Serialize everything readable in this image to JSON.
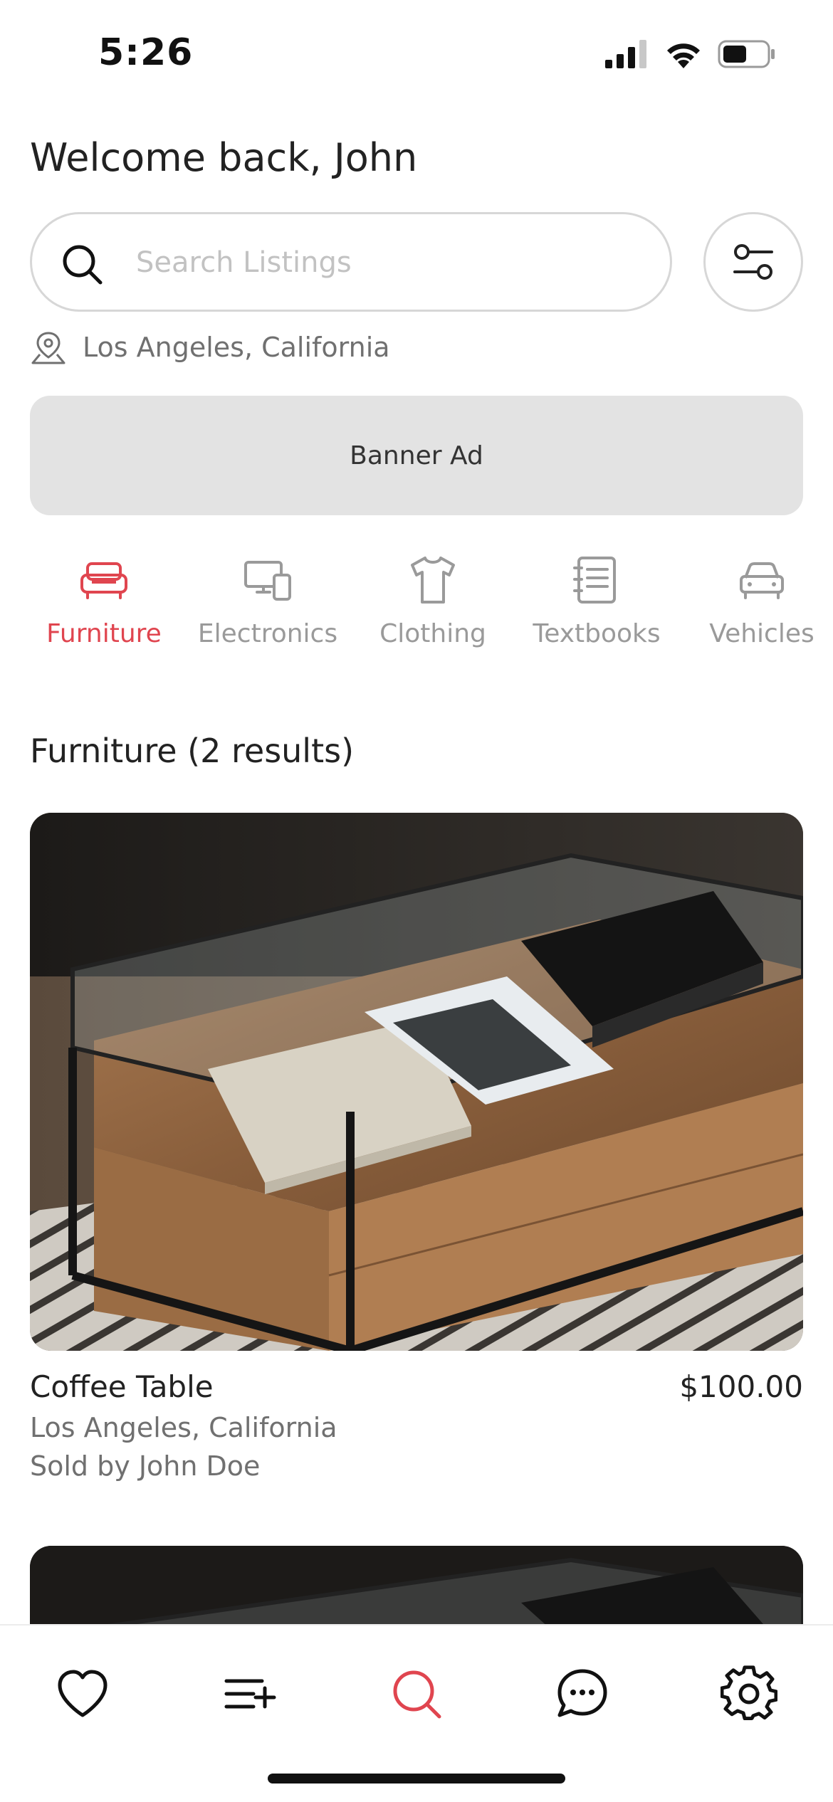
{
  "status_bar": {
    "time": "5:26"
  },
  "header": {
    "greeting": "Welcome back, John"
  },
  "search": {
    "placeholder": "Search Listings",
    "value": ""
  },
  "location": {
    "label": "Los Angeles, California"
  },
  "banner": {
    "label": "Banner Ad"
  },
  "categories": [
    {
      "label": "Furniture",
      "icon": "sofa-icon",
      "active": true
    },
    {
      "label": "Electronics",
      "icon": "devices-icon",
      "active": false
    },
    {
      "label": "Clothing",
      "icon": "shirt-icon",
      "active": false
    },
    {
      "label": "Textbooks",
      "icon": "notebook-icon",
      "active": false
    },
    {
      "label": "Vehicles",
      "icon": "car-icon",
      "active": false
    }
  ],
  "results": {
    "heading": "Furniture (2 results)"
  },
  "listings": [
    {
      "title": "Coffee Table",
      "price": "$100.00",
      "location": "Los Angeles, California",
      "seller": "Sold by John Doe"
    }
  ],
  "tab_bar": {
    "items": [
      {
        "icon": "heart-icon",
        "active": false
      },
      {
        "icon": "list-add-icon",
        "active": false
      },
      {
        "icon": "search-icon",
        "active": true
      },
      {
        "icon": "chat-icon",
        "active": false
      },
      {
        "icon": "settings-icon",
        "active": false
      }
    ]
  },
  "colors": {
    "accent": "#e0454f",
    "inactive": "#9a9a9a",
    "text": "#222222",
    "muted": "#707070",
    "banner_bg": "#e3e3e3"
  }
}
